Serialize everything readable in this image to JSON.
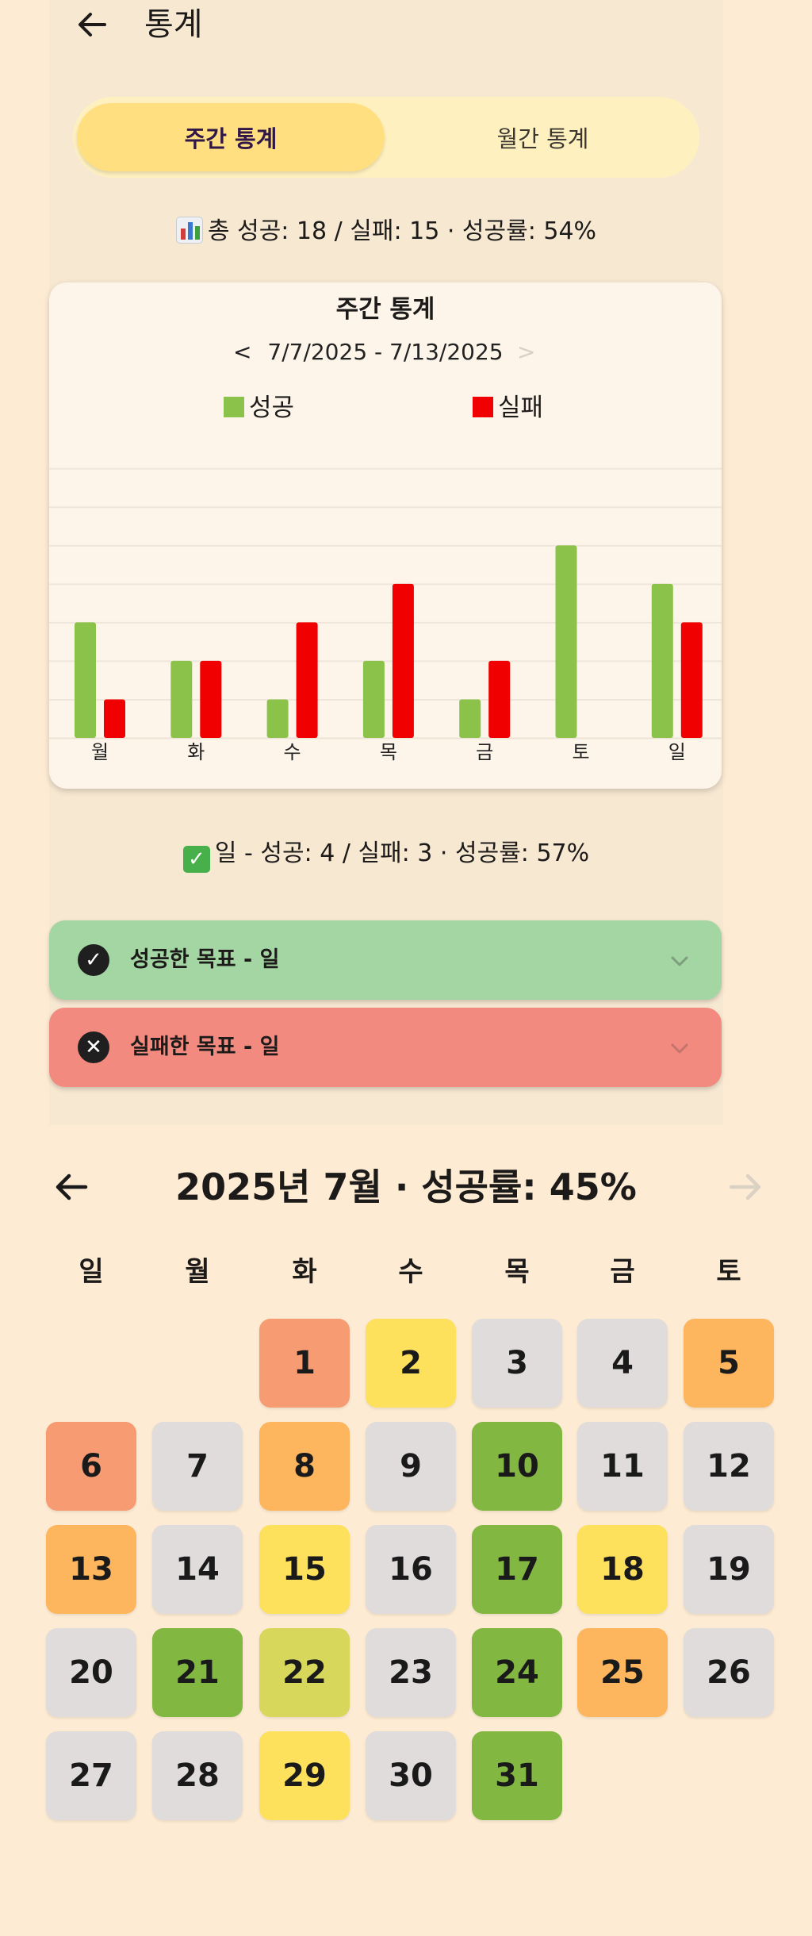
{
  "appbar": {
    "title": "통계"
  },
  "tabs": {
    "weekly": "주간 통계",
    "monthly": "월간 통계"
  },
  "summary": {
    "total": "총 성공: 18 / 실패: 15 · 성공률: 54%",
    "day": "일 - 성공: 4 / 실패: 3 · 성공률: 57%"
  },
  "chart_card": {
    "title": "주간 통계",
    "prev": "<",
    "range": "7/7/2025 - 7/13/2025",
    "next": ">"
  },
  "chart_data": {
    "type": "bar",
    "title": "주간 통계",
    "categories": [
      "월",
      "화",
      "수",
      "목",
      "금",
      "토",
      "일"
    ],
    "series": [
      {
        "name": "성공",
        "color": "#8bc34a",
        "values": [
          3,
          2,
          1,
          2,
          1,
          5,
          4
        ]
      },
      {
        "name": "실패",
        "color": "#f00000",
        "values": [
          1,
          2,
          3,
          4,
          2,
          0,
          3
        ]
      }
    ],
    "ylim": [
      0,
      7.5
    ],
    "grid": true,
    "legend": "top"
  },
  "goals": {
    "success_label": "성공한 목표 - 일",
    "fail_label": "실패한 목표 - 일",
    "success_icon": "check-circle-icon",
    "fail_icon": "x-circle-icon"
  },
  "calendar": {
    "title": "2025년 7월 · 성공률: 45%",
    "weekdays": [
      "일",
      "월",
      "화",
      "수",
      "목",
      "금",
      "토"
    ],
    "first_weekday": 2,
    "colors": {
      "gray": "#e0dcdc",
      "yellow": "#fde15d",
      "orange": "#fdb55e",
      "salmon": "#f79b72",
      "green": "#82b842",
      "olive": "#d7d75b"
    },
    "days": [
      {
        "d": "1",
        "c": "salmon"
      },
      {
        "d": "2",
        "c": "yellow"
      },
      {
        "d": "3",
        "c": "gray"
      },
      {
        "d": "4",
        "c": "gray"
      },
      {
        "d": "5",
        "c": "orange"
      },
      {
        "d": "6",
        "c": "salmon"
      },
      {
        "d": "7",
        "c": "gray"
      },
      {
        "d": "8",
        "c": "orange"
      },
      {
        "d": "9",
        "c": "gray"
      },
      {
        "d": "10",
        "c": "green"
      },
      {
        "d": "11",
        "c": "gray"
      },
      {
        "d": "12",
        "c": "gray"
      },
      {
        "d": "13",
        "c": "orange"
      },
      {
        "d": "14",
        "c": "gray"
      },
      {
        "d": "15",
        "c": "yellow"
      },
      {
        "d": "16",
        "c": "gray"
      },
      {
        "d": "17",
        "c": "green"
      },
      {
        "d": "18",
        "c": "yellow"
      },
      {
        "d": "19",
        "c": "gray"
      },
      {
        "d": "20",
        "c": "gray"
      },
      {
        "d": "21",
        "c": "green"
      },
      {
        "d": "22",
        "c": "olive"
      },
      {
        "d": "23",
        "c": "gray"
      },
      {
        "d": "24",
        "c": "green"
      },
      {
        "d": "25",
        "c": "orange"
      },
      {
        "d": "26",
        "c": "gray"
      },
      {
        "d": "27",
        "c": "gray"
      },
      {
        "d": "28",
        "c": "gray"
      },
      {
        "d": "29",
        "c": "yellow"
      },
      {
        "d": "30",
        "c": "gray"
      },
      {
        "d": "31",
        "c": "green"
      }
    ]
  }
}
